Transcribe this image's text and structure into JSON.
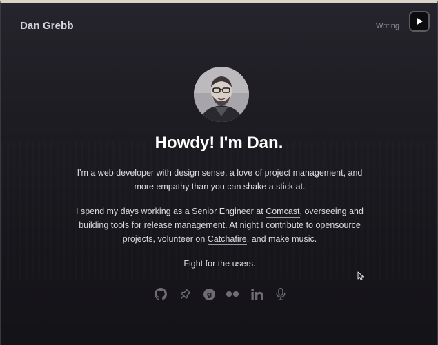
{
  "header": {
    "brand": "Dan Grebb",
    "nav": {
      "writing_label": "Writing"
    }
  },
  "hero": {
    "headline": "Howdy! I'm Dan.",
    "intro": "I'm a web developer with design sense, a love of project management, and more empathy than you can shake a stick at.",
    "bio_before": "I spend my days working as a Senior Engineer at ",
    "bio_link_1": "Comcast",
    "bio_middle": ", overseeing and building tools for release management. At night I contribute to opensource projects, volunteer on ",
    "bio_link_2": "Catchafire",
    "bio_after": ", and make music.",
    "tagline": "Fight for the users."
  },
  "socials": [
    {
      "icon": "github-icon"
    },
    {
      "icon": "pin-icon"
    },
    {
      "icon": "goodreads-icon"
    },
    {
      "icon": "flickr-icon"
    },
    {
      "icon": "linkedin-icon"
    },
    {
      "icon": "microphone-icon"
    }
  ],
  "colors": {
    "background": "#1d1c22",
    "text": "#dcdadf",
    "heading": "#ffffff",
    "muted": "#8d8a93",
    "icon": "#6e6b74"
  }
}
